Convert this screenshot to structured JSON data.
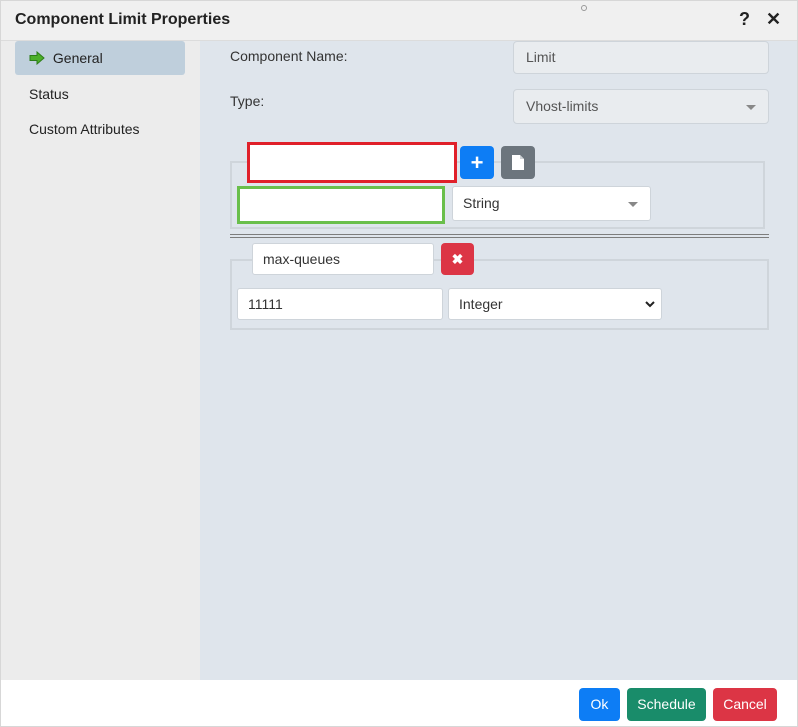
{
  "dialog": {
    "title": "Component Limit Properties",
    "help": "?",
    "close": "✕"
  },
  "sidebar": {
    "items": [
      {
        "label": "General",
        "active": true
      },
      {
        "label": "Status",
        "active": false
      },
      {
        "label": "Custom Attributes",
        "active": false
      }
    ]
  },
  "form": {
    "component_name_label": "Component Name:",
    "component_name_value": "Limit",
    "type_label": "Type:",
    "type_value": "Vhost-limits"
  },
  "new_attribute": {
    "name_value": "",
    "value_value": "",
    "type_value": "String",
    "add_icon": "+"
  },
  "attribute": {
    "name_value": "max-queues",
    "value_value": "11111",
    "type_value": "Integer",
    "remove_icon": "✖"
  },
  "footer": {
    "ok_label": "Ok",
    "schedule_label": "Schedule",
    "cancel_label": "Cancel"
  },
  "colors": {
    "primary": "#0d7df5",
    "success": "#198c6a",
    "danger": "#dc3545",
    "secondary": "#6c757d"
  }
}
